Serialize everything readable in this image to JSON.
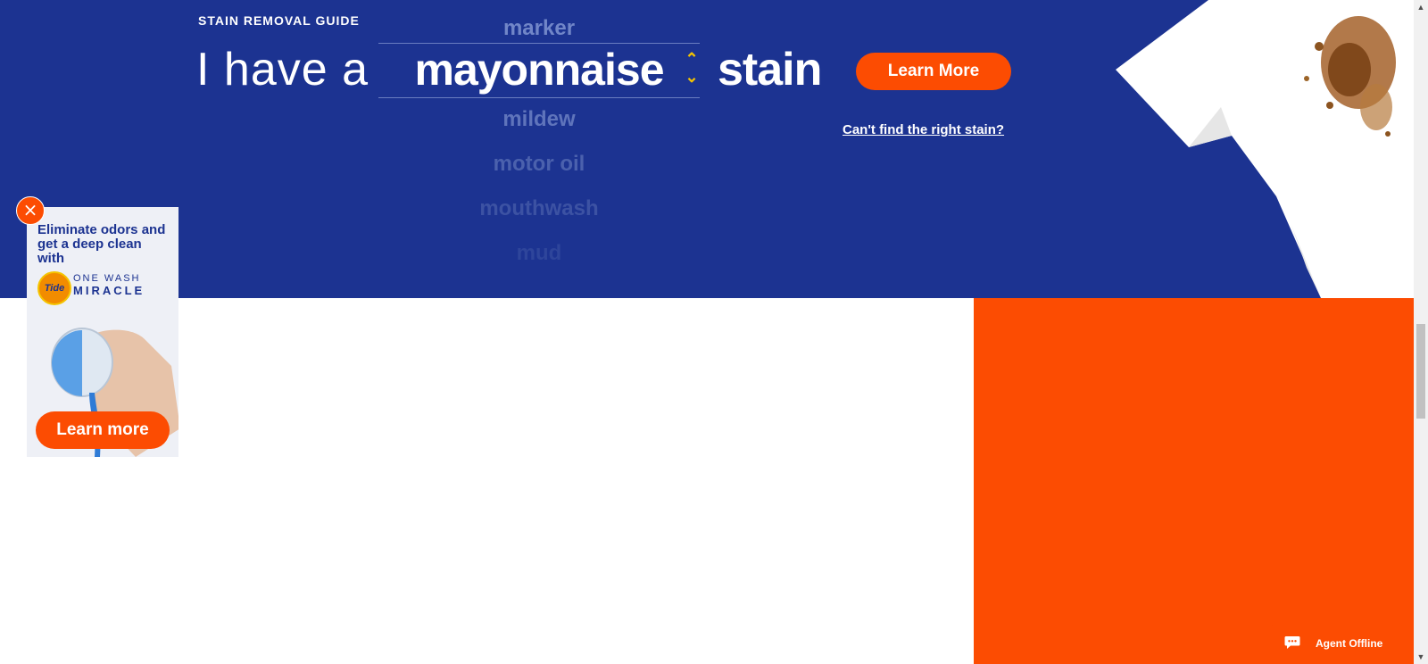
{
  "hero": {
    "eyebrow": "STAIN REMOVAL GUIDE",
    "prefix": "I have a",
    "picker_options": [
      "marker",
      "mayonnaise",
      "mildew",
      "motor oil",
      "mouthwash",
      "mud"
    ],
    "selected": "mayonnaise",
    "suffix": "stain",
    "cta_label": "Learn More",
    "help_link": "Can't find the right stain?",
    "colors": {
      "background": "#1c3391",
      "accent": "#fc4c02",
      "stepper": "#f5c400"
    }
  },
  "ad": {
    "headline": "Eliminate odors and get a deep clean with",
    "logo_text": "Tide",
    "brand_line1": "ONE WASH",
    "brand_line2": "MIRACLE",
    "cta_label": "Learn more",
    "close_icon": "close-icon"
  },
  "chat": {
    "label": "Agent Offline",
    "icon": "chat-bubble-icon"
  },
  "colors": {
    "orange_block": "#fc4c02"
  }
}
